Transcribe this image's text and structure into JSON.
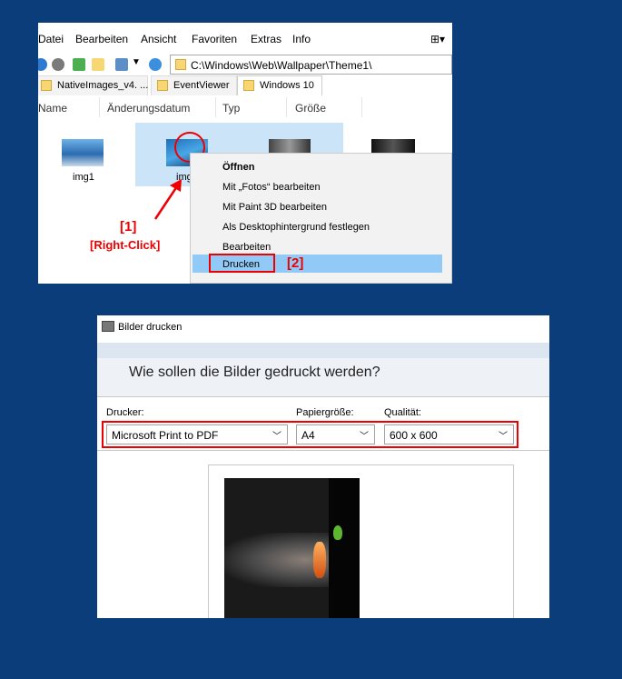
{
  "explorer": {
    "menu": [
      "Datei",
      "Bearbeiten",
      "Ansicht",
      "Favoriten",
      "Extras",
      "Info"
    ],
    "address": "C:\\Windows\\Web\\Wallpaper\\Theme1\\",
    "tabs": [
      "NativeImages_v4. ...",
      "EventViewer",
      "Windows 10"
    ],
    "columns": [
      "Name",
      "Änderungsdatum",
      "Typ",
      "Größe"
    ],
    "files": [
      {
        "name": "img1"
      },
      {
        "name": "img"
      }
    ],
    "context_menu": [
      "Öffnen",
      "Mit „Fotos“ bearbeiten",
      "Mit Paint 3D bearbeiten",
      "Als Desktophintergrund festlegen",
      "Bearbeiten",
      "Drucken"
    ]
  },
  "annotations": {
    "step1": "[1]",
    "step1_sub": "[Right-Click]",
    "step2": "[2]"
  },
  "dialog": {
    "title": "Bilder drucken",
    "question": "Wie sollen die Bilder gedruckt werden?",
    "printer_label": "Drucker:",
    "printer_value": "Microsoft Print to PDF",
    "paper_label": "Papiergröße:",
    "paper_value": "A4",
    "quality_label": "Qualität:",
    "quality_value": "600 x 600"
  },
  "colors": {
    "background": "#0a3d7a",
    "highlight": "#e00000",
    "selection": "#cce4f7",
    "menu_highlight": "#91c9f7"
  }
}
